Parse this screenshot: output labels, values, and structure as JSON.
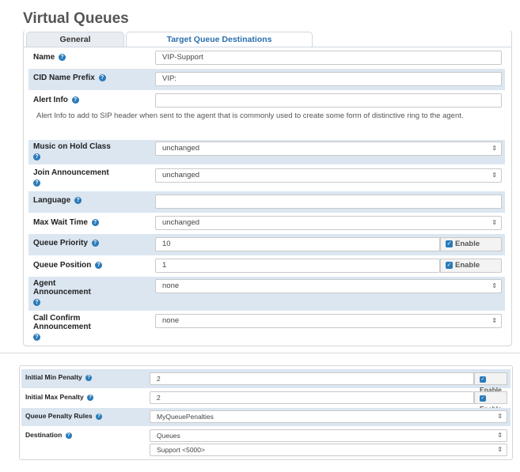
{
  "page": {
    "title": "Virtual Queues"
  },
  "tabs": [
    {
      "label": "General"
    },
    {
      "label": "Target Queue Destinations"
    }
  ],
  "form": {
    "name": {
      "label": "Name",
      "value": "VIP-Support"
    },
    "cid_prefix": {
      "label": "CID Name Prefix",
      "value": "VIP:"
    },
    "alert_info": {
      "label": "Alert Info",
      "value": "",
      "help": "Alert Info to add to SIP header when sent to the agent that is commonly used to create some form of distinctive ring to the agent."
    },
    "moh_class": {
      "label": "Music on Hold Class",
      "value": "unchanged"
    },
    "join_announcement": {
      "label": "Join Announcement",
      "value": "unchanged"
    },
    "language": {
      "label": "Language",
      "value": ""
    },
    "max_wait": {
      "label": "Max Wait Time",
      "value": "unchanged"
    },
    "queue_priority": {
      "label": "Queue Priority",
      "value": "10",
      "enable": "Enable"
    },
    "queue_position": {
      "label": "Queue Position",
      "value": "1",
      "enable": "Enable"
    },
    "agent_announcement": {
      "label_line1": "Agent",
      "label_line2": "Announcement",
      "value": "none"
    },
    "call_confirm": {
      "label_line1": "Call Confirm",
      "label_line2": "Announcement",
      "value": "none"
    }
  },
  "form2": {
    "initial_min_penalty": {
      "label": "Initial Min Penalty",
      "value": "2",
      "enable": "Enable"
    },
    "initial_max_penalty": {
      "label": "Initial Max Penalty",
      "value": "2",
      "enable": "Enable"
    },
    "penalty_rules": {
      "label": "Queue Penalty Rules",
      "value": "MyQueuePenalties"
    },
    "destination": {
      "label": "Destination",
      "type_value": "Queues",
      "target_value": "Support <5000>"
    }
  },
  "icons": {
    "help": "help-circle-icon",
    "caret": "select-caret-icon",
    "check": "checkbox-checked-icon"
  },
  "colors": {
    "accent": "#2a7ab8",
    "row_shade": "#dbe6f1",
    "tab_link": "#2a6fb0"
  }
}
